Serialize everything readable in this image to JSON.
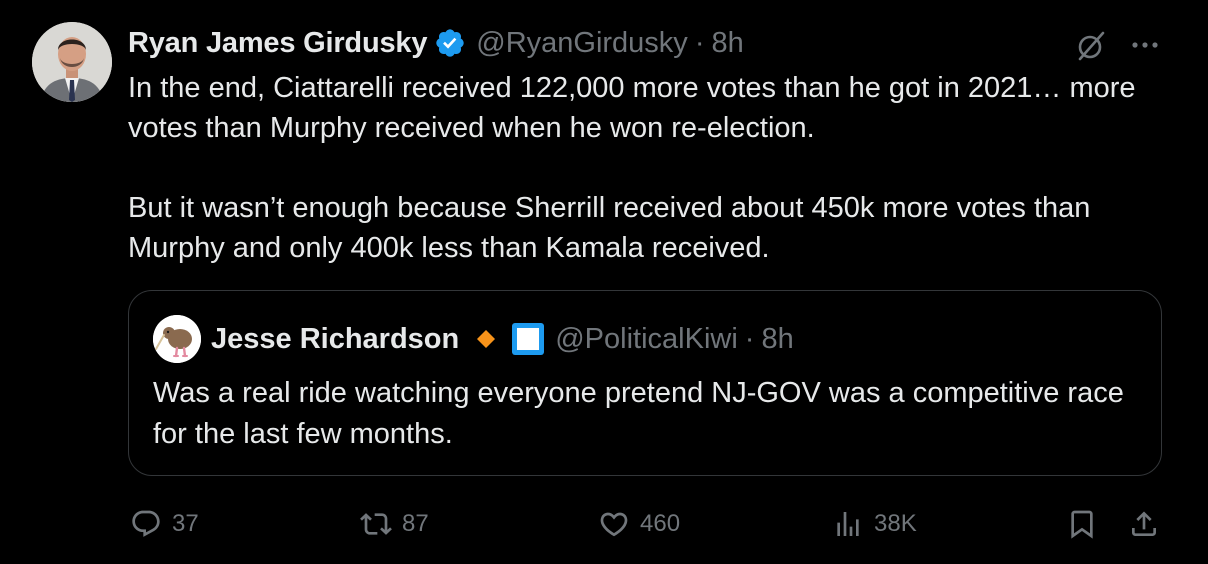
{
  "tweet": {
    "author_name": "Ryan James Girdusky",
    "author_handle": "@RyanGirdusky",
    "separator": "·",
    "time": "8h",
    "text_line1": "In the end, Ciattarelli received 122,000 more votes than he got in 2021… more votes than Murphy received when he won re-election.",
    "text_line2": "But it wasn’t enough because Sherrill received about 450k more votes than Murphy and only 400k less than Kamala received."
  },
  "quote": {
    "author_name": "Jesse Richardson",
    "author_handle": "@PoliticalKiwi",
    "separator": "·",
    "time": "8h",
    "text": "Was a real ride watching everyone pretend NJ-GOV was a competitive race for the last few months."
  },
  "actions": {
    "replies": "37",
    "reposts": "87",
    "likes": "460",
    "views": "38K"
  },
  "colors": {
    "background": "#000000",
    "text_primary": "#e7e9ea",
    "text_secondary": "#71767b",
    "verified_blue": "#1d9bf0",
    "border": "#333639",
    "diamond_orange": "#f7931a"
  },
  "icons": [
    "verified-badge-icon",
    "grok-icon",
    "more-icon",
    "diamond-icon",
    "square-badge-icon",
    "reply-icon",
    "repost-icon",
    "like-icon",
    "views-icon",
    "bookmark-icon",
    "share-icon"
  ]
}
